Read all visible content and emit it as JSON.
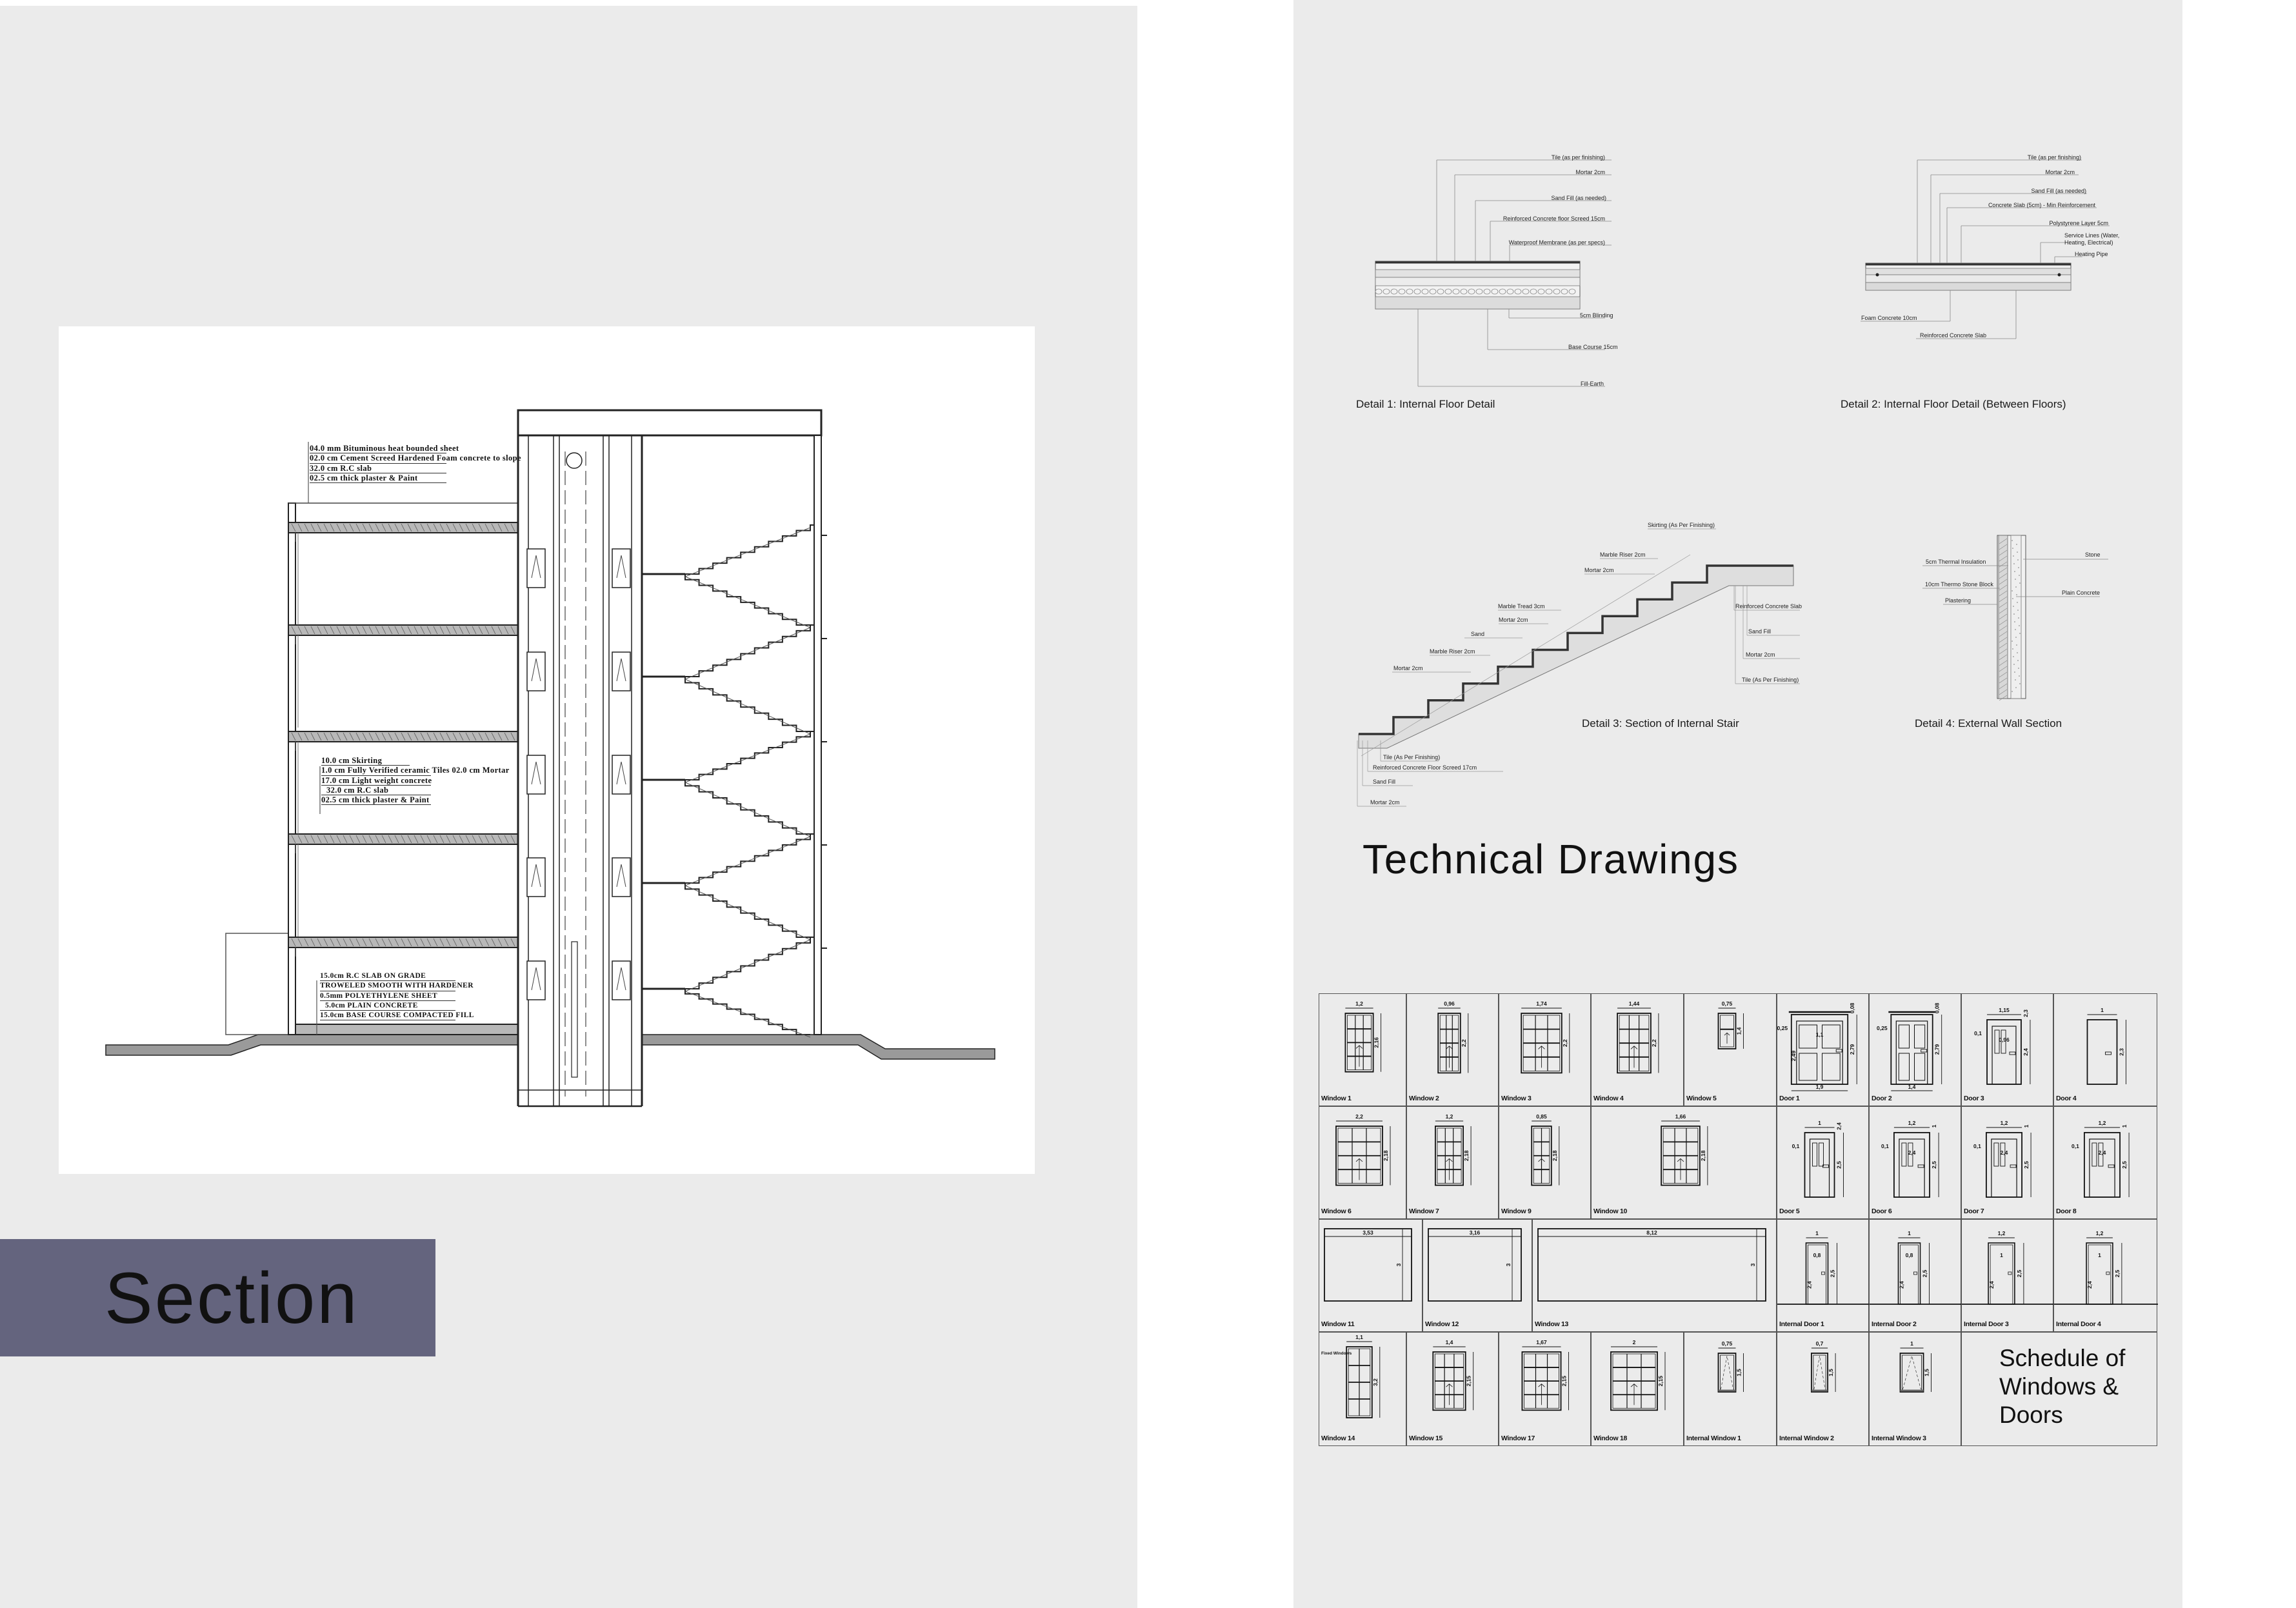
{
  "section": {
    "heading": "Section",
    "roof_notes": [
      "04.0 mm Bituminous heat bounded sheet",
      "02.0 cm Cement Screed Hardened Foam concrete to slope",
      "32.0 cm R.C slab",
      "02.5 cm thick plaster & Paint"
    ],
    "floor_notes": [
      "10.0 cm Skirting",
      "1.0 cm Fully Verified ceramic Tiles   02.0 cm Mortar",
      "17.0 cm Light weight concrete",
      "32.0 cm R.C slab",
      "02.5 cm thick plaster & Paint"
    ],
    "ground_notes": [
      "15.0cm R.C SLAB ON GRADE",
      "TROWELED SMOOTH WITH HARDENER",
      "0.5mm POLYETHYLENE SHEET",
      "5.0cm PLAIN CONCRETE",
      "15.0cm BASE COURSE COMPACTED FILL"
    ]
  },
  "technical": {
    "title": "Technical Drawings",
    "detail1": {
      "title": "Detail 1: Internal Floor Detail",
      "labels": [
        "Tile (as per finishing)",
        "Mortar 2cm",
        "Sand Fill (as needed)",
        "Reinforced Concrete floor Screed 15cm",
        "Waterproof Membrane (as per specs)",
        "5cm Blinding",
        "Base Course 15cm",
        "Fill-Earth"
      ]
    },
    "detail2": {
      "title": "Detail 2: Internal Floor Detail (Between Floors)",
      "labels": [
        "Tile (as per finishing)",
        "Mortar 2cm",
        "Sand Fill (as needed)",
        "Concrete Slab (5cm) - Min Reinforcement",
        "Polystyrene Layer 5cm",
        "Service Lines (Water,",
        "Heating, Electrical)",
        "Heating Pipe",
        "Foam Concrete 10cm",
        "Reinforced Concrete Slab"
      ]
    },
    "detail3": {
      "title": "Detail 3: Section of Internal Stair",
      "labels": [
        "Skirting (As Per Finishing)",
        "Marble Riser 2cm",
        "Mortar 2cm",
        "Marble Tread 3cm",
        "Mortar 2cm",
        "Sand",
        "Marble Riser 2cm",
        "Mortar 2cm",
        "Reinforced Concrete Slab",
        "Sand Fill",
        "Mortar 2cm",
        "Tile (As Per Finishing)",
        "Tile (As Per Finishing)",
        "Reinforced Concrete Floor Screed 17cm",
        "Sand Fill",
        "Mortar 2cm"
      ]
    },
    "detail4": {
      "title": "Detail 4: External Wall Section",
      "labels": [
        "5cm Thermal Insulation",
        "10cm Thermo Stone Block",
        "Plastering",
        "Stone",
        "Plain Concrete"
      ]
    }
  },
  "schedule": {
    "title_lines": [
      "Schedule of",
      "Windows &",
      "Doors"
    ],
    "rows": [
      [
        {
          "label": "Window 1",
          "type": "window",
          "w": "1,2",
          "h": "2,16"
        },
        {
          "label": "Window 2",
          "type": "window",
          "w": "0,96",
          "h": "2,2"
        },
        {
          "label": "Window 3",
          "type": "window",
          "w": "1,74",
          "h": "2,2"
        },
        {
          "label": "Window 4",
          "type": "window",
          "w": "1,44",
          "h": "2,2"
        },
        {
          "label": "Window 5",
          "type": "window-single",
          "w": "0,75",
          "h": "1,4"
        },
        {
          "label": "Door 1",
          "type": "door-double",
          "w": "1,9",
          "h": "2,79",
          "extra": [
            "0,25",
            "0,08",
            "1,1",
            "2,49"
          ]
        },
        {
          "label": "Door 2",
          "type": "door-double",
          "w": "1,4",
          "h": "2,79",
          "extra": [
            "0,25",
            "0,08"
          ]
        },
        {
          "label": "Door 3",
          "type": "door",
          "w": "1,15",
          "h": "2,4",
          "extra": [
            "0,1",
            "2,3",
            "0,96"
          ]
        },
        {
          "label": "Door 4",
          "type": "door-plain",
          "w": "1",
          "h": "2,3"
        }
      ],
      [
        {
          "label": "Window 6",
          "type": "window",
          "w": "2,2",
          "h": "2,18"
        },
        {
          "label": "Window 7",
          "type": "window",
          "w": "1,2",
          "h": "2,18"
        },
        {
          "label": "Window 9",
          "type": "window",
          "w": "0,85",
          "h": "2,18"
        },
        {
          "label": "Window 10",
          "type": "window",
          "w": "1,66",
          "h": "2,18"
        },
        {
          "label": "Door 5",
          "type": "door",
          "w": "1",
          "h": "2,5",
          "extra": [
            "0,1",
            "2,4"
          ]
        },
        {
          "label": "Door 6",
          "type": "door",
          "w": "1,2",
          "h": "2,5",
          "extra": [
            "0,1",
            "1",
            "2,4"
          ]
        },
        {
          "label": "Door 7",
          "type": "door",
          "w": "1,2",
          "h": "2,5",
          "extra": [
            "0,1",
            "1",
            "2,4"
          ]
        },
        {
          "label": "Door 8",
          "type": "door",
          "w": "1,2",
          "h": "2,5",
          "extra": [
            "0,1",
            "1",
            "2,4"
          ]
        }
      ],
      [
        {
          "label": "Window 11",
          "type": "panel",
          "w": "3,53",
          "h": "3"
        },
        {
          "label": "Window 12",
          "type": "panel",
          "w": "3,16",
          "h": "3"
        },
        {
          "label": "Window 13",
          "type": "panel",
          "w": "8,12",
          "h": "3"
        },
        {
          "label": "Internal Door 1",
          "type": "internal-door",
          "w": "1",
          "h": "2,5",
          "extra": [
            "0,8",
            "2,4"
          ]
        },
        {
          "label": "Internal Door 2",
          "type": "internal-door",
          "w": "1",
          "h": "2,5",
          "extra": [
            "0,8",
            "2,4"
          ]
        },
        {
          "label": "Internal Door 3",
          "type": "internal-door",
          "w": "1,2",
          "h": "2,5",
          "extra": [
            "1",
            "2,4"
          ]
        },
        {
          "label": "Internal Door 4",
          "type": "internal-door",
          "w": "1,2",
          "h": "2,5",
          "extra": [
            "1",
            "2,4"
          ]
        }
      ],
      [
        {
          "label": "Window 14",
          "type": "fixed-window",
          "w": "1,1",
          "h": "3,2",
          "note": "Fixed Windows"
        },
        {
          "label": "Window 15",
          "type": "window",
          "w": "1,4",
          "h": "2,15"
        },
        {
          "label": "Window 17",
          "type": "window",
          "w": "1,67",
          "h": "2,15"
        },
        {
          "label": "Window 18",
          "type": "window",
          "w": "2",
          "h": "2,15"
        },
        {
          "label": "Internal Window 1",
          "type": "internal-window",
          "w": "0,75",
          "h": "1,5"
        },
        {
          "label": "Internal Window 2",
          "type": "internal-window",
          "w": "0,7",
          "h": "1,5"
        },
        {
          "label": "Internal Window 3",
          "type": "internal-window",
          "w": "1",
          "h": "1,5"
        }
      ]
    ]
  }
}
